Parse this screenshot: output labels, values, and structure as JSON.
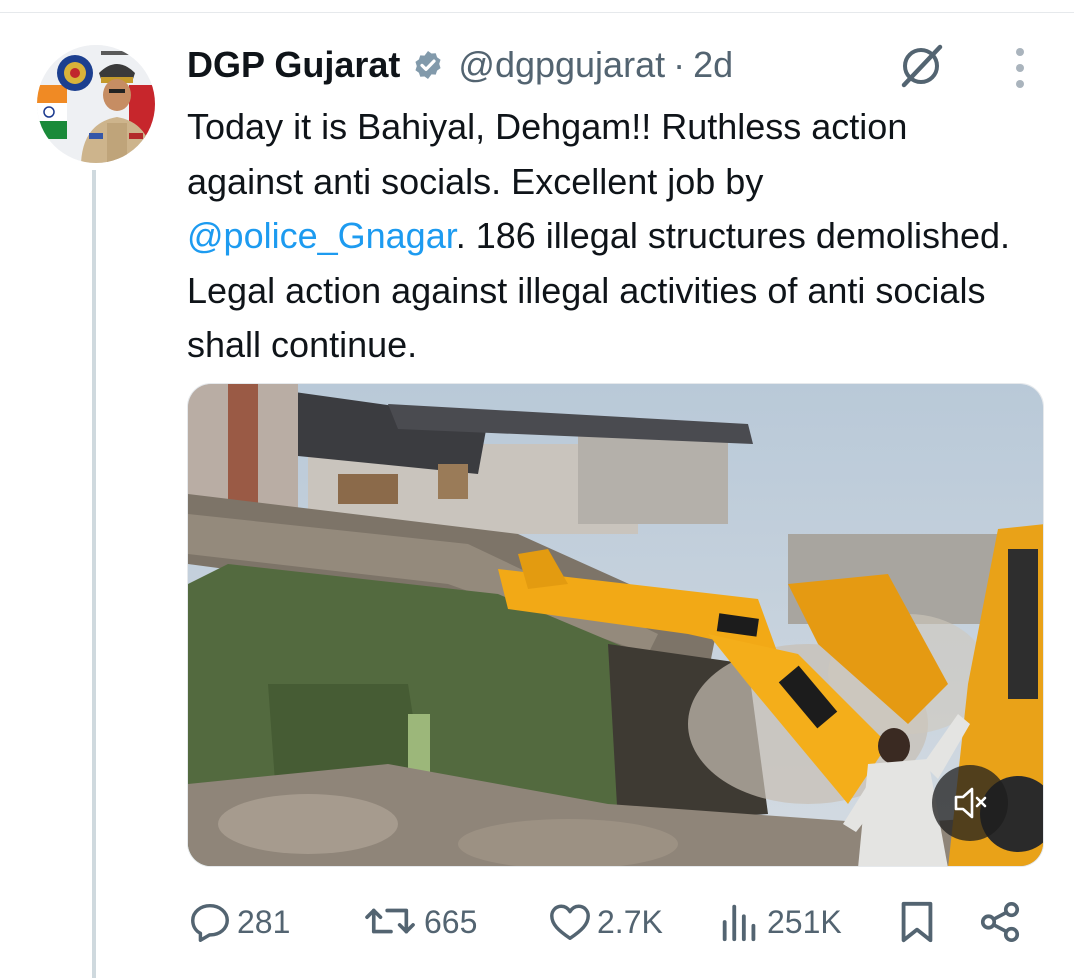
{
  "tweet": {
    "display_name": "DGP Gujarat",
    "handle": "@dgpgujarat",
    "separator": "·",
    "time": "2d",
    "text_before_mention": "Today it is Bahiyal, Dehgam!! Ruthless action against anti socials. Excellent job by ",
    "mention": "@police_Gnagar",
    "text_after_mention": ". 186 illegal structures demolished. Legal action against illegal activities of anti socials shall continue."
  },
  "actions": {
    "replies": "281",
    "reposts": "665",
    "likes": "2.7K",
    "views": "251K"
  },
  "icons": {
    "verified": "verified-badge-icon",
    "grok": "grok-icon",
    "more": "more-icon",
    "mute": "mute-icon",
    "reply": "reply-icon",
    "repost": "repost-icon",
    "like": "like-icon",
    "views": "views-icon",
    "bookmark": "bookmark-icon",
    "share": "share-icon"
  },
  "colors": {
    "text": "#0f1419",
    "secondary": "#536471",
    "link": "#1d9bf0",
    "thread_line": "#cfd9de"
  }
}
